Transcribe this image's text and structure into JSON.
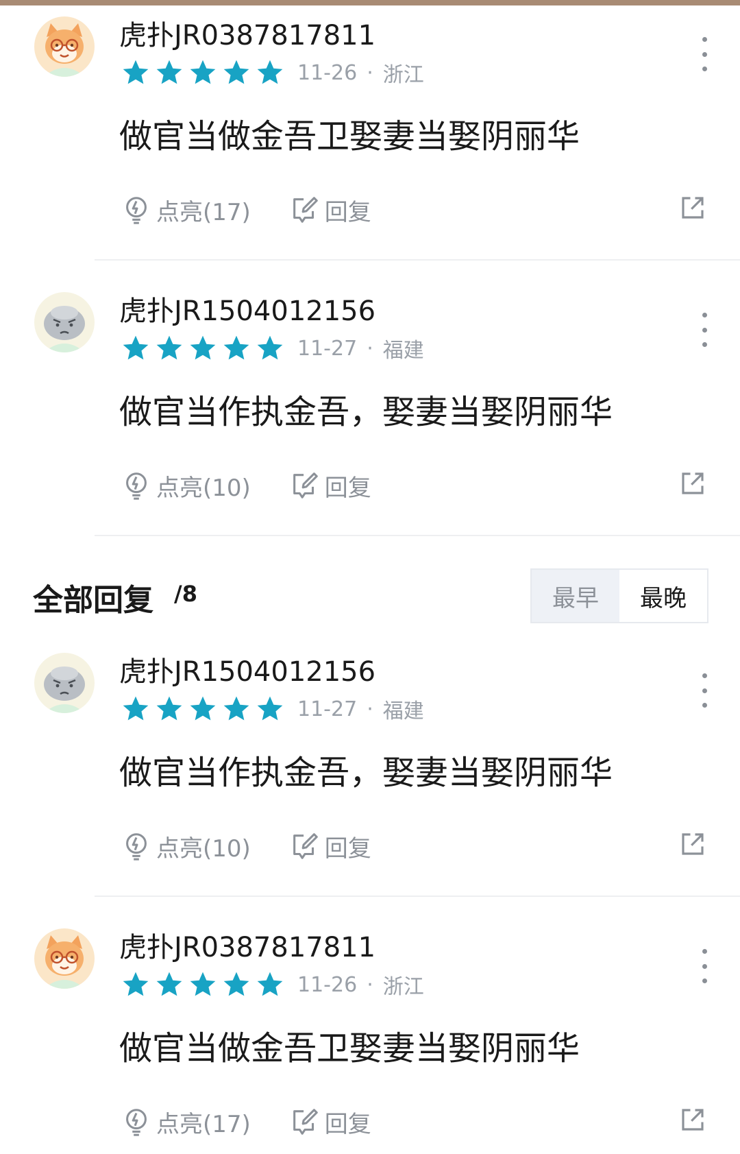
{
  "colors": {
    "star": "#18a3c4",
    "meta_text": "#9aa0a8",
    "action_text": "#8c9198",
    "top_bar": "#a88b74"
  },
  "comments_top": [
    {
      "avatar": "fox-avatar",
      "username": "虎扑JR0387817811",
      "rating": 5,
      "date": "11-26",
      "location": "浙江",
      "text": "做官当做金吾卫娶妻当娶阴丽华",
      "light_label": "点亮(17)",
      "reply_label": "回复"
    },
    {
      "avatar": "grumpy-avatar",
      "username": "虎扑JR1504012156",
      "rating": 5,
      "date": "11-27",
      "location": "福建",
      "text": "做官当作执金吾，娶妻当娶阴丽华",
      "light_label": "点亮(10)",
      "reply_label": "回复"
    }
  ],
  "all_replies": {
    "title": "全部回复",
    "count": "/8",
    "sort_earliest": "最早",
    "sort_latest": "最晚",
    "selected_sort": "最晚"
  },
  "comments_bottom": [
    {
      "avatar": "grumpy-avatar",
      "username": "虎扑JR1504012156",
      "rating": 5,
      "date": "11-27",
      "location": "福建",
      "text": "做官当作执金吾，娶妻当娶阴丽华",
      "light_label": "点亮(10)",
      "reply_label": "回复"
    },
    {
      "avatar": "fox-avatar",
      "username": "虎扑JR0387817811",
      "rating": 5,
      "date": "11-26",
      "location": "浙江",
      "text": "做官当做金吾卫娶妻当娶阴丽华",
      "light_label": "点亮(17)",
      "reply_label": "回复"
    }
  ]
}
